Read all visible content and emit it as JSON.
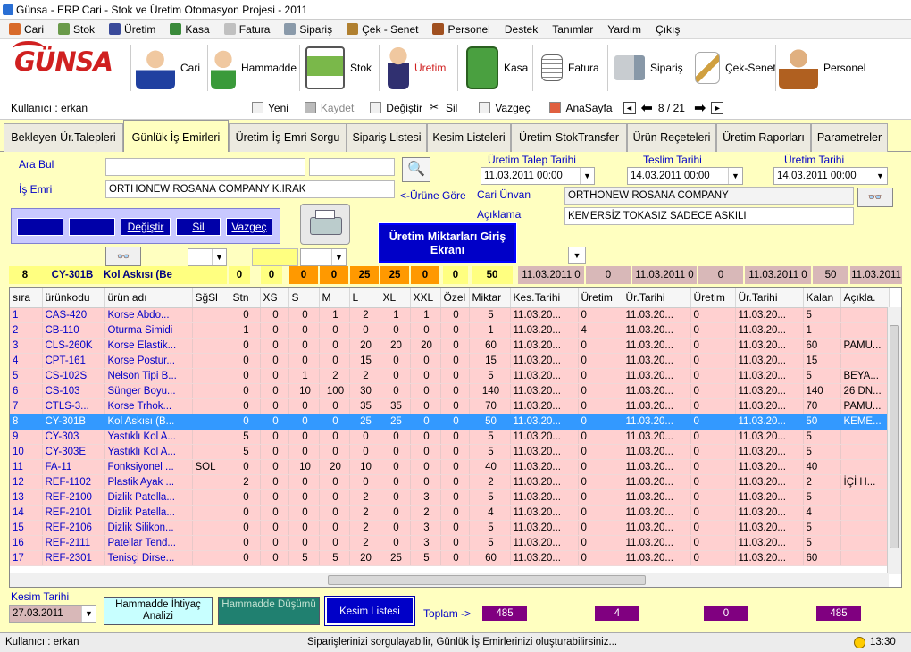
{
  "window": {
    "title": "Günsa - ERP Cari - Stok ve Üretim Otomasyon Projesi  -  2011"
  },
  "menu": [
    "Cari",
    "Stok",
    "Üretim",
    "Kasa",
    "Fatura",
    "Sipariş",
    "Çek - Senet",
    "Personel",
    "Destek",
    "Tanımlar",
    "Yardım",
    "Çıkış"
  ],
  "toolbar": {
    "logo": "GÜNSA",
    "buttons": [
      "Cari",
      "Hammadde",
      "Stok",
      "Üretim",
      "Kasa",
      "Fatura",
      "Sipariş",
      "Çek-Senet",
      "Personel"
    ]
  },
  "cmdbar": {
    "user": "Kullanıcı : erkan",
    "new": "Yeni",
    "save": "Kaydet",
    "edit": "Değiştir",
    "delete": "Sil",
    "cancel": "Vazgeç",
    "home": "AnaSayfa",
    "page": "8 / 21"
  },
  "tabs": [
    "Bekleyen Ür.Talepleri",
    "Günlük İş Emirleri",
    "Üretim-İş Emri Sorgu",
    "Sipariş Listesi",
    "Kesim Listeleri",
    "Üretim-StokTransfer",
    "Ürün Reçeteleri",
    "Üretim Raporları",
    "Parametreler"
  ],
  "form": {
    "search_label": "Ara Bul",
    "order_label": "İş Emri",
    "order_value": "ORTHONEW ROSANA COMPANY   K.IRAK",
    "by_product": "<-Ürüne Göre",
    "req_date_label": "Üretim Talep Tarihi",
    "req_date": "11.03.2011 00:00",
    "delivery_label": "Teslim Tarihi",
    "delivery_date": "14.03.2011 00:00",
    "prod_date_label": "Üretim Tarihi",
    "prod_date": "14.03.2011 00:00",
    "customer_label": "Cari Ünvan",
    "customer": "ORTHONEW ROSANA COMPANY",
    "desc_label": "Açıklama",
    "desc": "KEMERSİZ TOKASIZ SADECE ASKILI",
    "btn_edit": "Değiştir",
    "btn_delete": "Sil",
    "btn_cancel": "Vazgeç",
    "qty_button": "Üretim Miktarları Giriş Ekranı"
  },
  "summary": [
    "8",
    "CY-301B",
    "Kol Askısı (Be",
    "",
    "0",
    "0",
    "0",
    "0",
    "25",
    "25",
    "0",
    "0",
    "50",
    "11.03.2011 0",
    "0",
    "11.03.2011 0",
    "0",
    "11.03.2011 0",
    "50",
    "11.03.2011"
  ],
  "table": {
    "headers": [
      "sıra",
      "ürünkodu",
      "ürün adı",
      "SğSl",
      "Stn",
      "XS",
      "S",
      "M",
      "L",
      "XL",
      "XXL",
      "Özel",
      "Miktar",
      "Kes.Tarihi",
      "Üretim",
      "Ür.Tarihi",
      "Üretim",
      "Ür.Tarihi",
      "Kalan",
      "Açıkla."
    ],
    "selected_index": 7,
    "rows": [
      [
        "1",
        "CAS-420",
        "Korse Abdo...",
        "",
        "0",
        "0",
        "0",
        "1",
        "2",
        "1",
        "1",
        "0",
        "5",
        "11.03.20...",
        "0",
        "11.03.20...",
        "0",
        "11.03.20...",
        "5",
        ""
      ],
      [
        "2",
        "CB-110",
        "Oturma Simidi",
        "",
        "1",
        "0",
        "0",
        "0",
        "0",
        "0",
        "0",
        "0",
        "1",
        "11.03.20...",
        "4",
        "11.03.20...",
        "0",
        "11.03.20...",
        "1",
        ""
      ],
      [
        "3",
        "CLS-260K",
        "Korse Elastik...",
        "",
        "0",
        "0",
        "0",
        "0",
        "20",
        "20",
        "20",
        "0",
        "60",
        "11.03.20...",
        "0",
        "11.03.20...",
        "0",
        "11.03.20...",
        "60",
        "PAMU..."
      ],
      [
        "4",
        "CPT-161",
        "Korse Postur...",
        "",
        "0",
        "0",
        "0",
        "0",
        "15",
        "0",
        "0",
        "0",
        "15",
        "11.03.20...",
        "0",
        "11.03.20...",
        "0",
        "11.03.20...",
        "15",
        ""
      ],
      [
        "5",
        "CS-102S",
        "Nelson Tipi B...",
        "",
        "0",
        "0",
        "1",
        "2",
        "2",
        "0",
        "0",
        "0",
        "5",
        "11.03.20...",
        "0",
        "11.03.20...",
        "0",
        "11.03.20...",
        "5",
        "BEYA..."
      ],
      [
        "6",
        "CS-103",
        "Sünger Boyu...",
        "",
        "0",
        "0",
        "10",
        "100",
        "30",
        "0",
        "0",
        "0",
        "140",
        "11.03.20...",
        "0",
        "11.03.20...",
        "0",
        "11.03.20...",
        "140",
        "26 DN..."
      ],
      [
        "7",
        "CTLS-3...",
        "Korse Trhok...",
        "",
        "0",
        "0",
        "0",
        "0",
        "35",
        "35",
        "0",
        "0",
        "70",
        "11.03.20...",
        "0",
        "11.03.20...",
        "0",
        "11.03.20...",
        "70",
        "PAMU..."
      ],
      [
        "8",
        "CY-301B",
        "Kol Askısı (B...",
        "",
        "0",
        "0",
        "0",
        "0",
        "25",
        "25",
        "0",
        "0",
        "50",
        "11.03.20...",
        "0",
        "11.03.20...",
        "0",
        "11.03.20...",
        "50",
        "KEME..."
      ],
      [
        "9",
        "CY-303",
        "Yastıklı Kol A...",
        "",
        "5",
        "0",
        "0",
        "0",
        "0",
        "0",
        "0",
        "0",
        "5",
        "11.03.20...",
        "0",
        "11.03.20...",
        "0",
        "11.03.20...",
        "5",
        ""
      ],
      [
        "10",
        "CY-303E",
        "Yastıklı Kol A...",
        "",
        "5",
        "0",
        "0",
        "0",
        "0",
        "0",
        "0",
        "0",
        "5",
        "11.03.20...",
        "0",
        "11.03.20...",
        "0",
        "11.03.20...",
        "5",
        ""
      ],
      [
        "11",
        "FA-11",
        "Fonksiyonel ...",
        "SOL",
        "0",
        "0",
        "10",
        "20",
        "10",
        "0",
        "0",
        "0",
        "40",
        "11.03.20...",
        "0",
        "11.03.20...",
        "0",
        "11.03.20...",
        "40",
        ""
      ],
      [
        "12",
        "REF-1102",
        "Plastik Ayak ...",
        "",
        "2",
        "0",
        "0",
        "0",
        "0",
        "0",
        "0",
        "0",
        "2",
        "11.03.20...",
        "0",
        "11.03.20...",
        "0",
        "11.03.20...",
        "2",
        "İÇİ H..."
      ],
      [
        "13",
        "REF-2100",
        "Dizlik Patella...",
        "",
        "0",
        "0",
        "0",
        "0",
        "2",
        "0",
        "3",
        "0",
        "5",
        "11.03.20...",
        "0",
        "11.03.20...",
        "0",
        "11.03.20...",
        "5",
        ""
      ],
      [
        "14",
        "REF-2101",
        "Dizlik Patella...",
        "",
        "0",
        "0",
        "0",
        "0",
        "2",
        "0",
        "2",
        "0",
        "4",
        "11.03.20...",
        "0",
        "11.03.20...",
        "0",
        "11.03.20...",
        "4",
        ""
      ],
      [
        "15",
        "REF-2106",
        "Dizlik Silikon...",
        "",
        "0",
        "0",
        "0",
        "0",
        "2",
        "0",
        "3",
        "0",
        "5",
        "11.03.20...",
        "0",
        "11.03.20...",
        "0",
        "11.03.20...",
        "5",
        ""
      ],
      [
        "16",
        "REF-2111",
        "Patellar Tend...",
        "",
        "0",
        "0",
        "0",
        "0",
        "2",
        "0",
        "3",
        "0",
        "5",
        "11.03.20...",
        "0",
        "11.03.20...",
        "0",
        "11.03.20...",
        "5",
        ""
      ],
      [
        "17",
        "REF-2301",
        "Tenisçi Dirse...",
        "",
        "0",
        "0",
        "5",
        "5",
        "20",
        "25",
        "5",
        "0",
        "60",
        "11.03.20...",
        "0",
        "11.03.20...",
        "0",
        "11.03.20...",
        "60",
        ""
      ]
    ]
  },
  "bottom": {
    "cut_date_label": "Kesim Tarihi",
    "cut_date": "27.03.2011",
    "btn_analysis": "Hammadde İhtiyaç Analizi",
    "btn_deduct": "Hammadde Düşümü",
    "btn_cutlist": "Kesim Listesi",
    "total_label": "Toplam ->",
    "totals": [
      "485",
      "4",
      "0",
      "485"
    ]
  },
  "status": {
    "user": "Kullanıcı : erkan",
    "message": "Siparişlerinizi sorgulayabilir, Günlük İş Emirlerinizi oluşturabilirsiniz...",
    "time": "13:30"
  }
}
